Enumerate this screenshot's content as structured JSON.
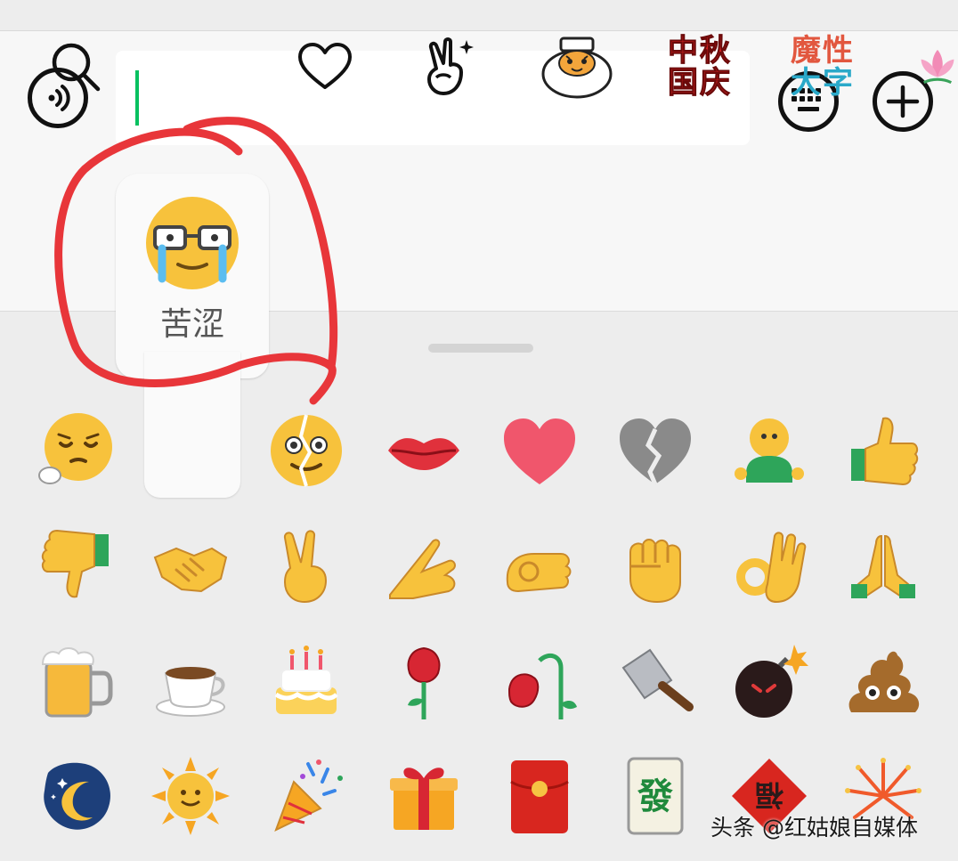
{
  "input": {
    "value": ""
  },
  "sticker_tabs": [
    {
      "name": "search-icon"
    },
    {
      "name": "emoji-tab",
      "label": "苦涩"
    },
    {
      "name": "heart-icon"
    },
    {
      "name": "hand-gesture-icon"
    },
    {
      "name": "tiger-sticker"
    },
    {
      "name": "sticker-pack-1",
      "text": "中秋国庆"
    },
    {
      "name": "sticker-pack-2",
      "text": "魔性大字"
    },
    {
      "name": "lotus-sticker"
    }
  ],
  "sticker_pack_1": {
    "line1": "中秋",
    "line2": "国庆"
  },
  "sticker_pack_2": {
    "line1": "魔性",
    "line2": "大字"
  },
  "preview": {
    "label": "苦涩",
    "icon": "bitter-tears-emoji"
  },
  "emoji_grid": [
    [
      "sigh-emoji",
      "",
      "crack-emoji",
      "lips-emoji",
      "heart-emoji",
      "broken-heart-emoji",
      "person-emoji",
      "thumbs-up-emoji"
    ],
    [
      "thumbs-down-emoji",
      "handshake-emoji",
      "victory-hand-emoji",
      "clap-hands-emoji",
      "fist-tap-emoji",
      "fist-emoji",
      "ok-hand-emoji",
      "pray-hands-emoji"
    ],
    [
      "beer-emoji",
      "coffee-emoji",
      "cake-emoji",
      "rose-emoji",
      "wilted-rose-emoji",
      "cleaver-emoji",
      "bomb-emoji",
      "poop-emoji"
    ],
    [
      "moon-emoji",
      "sun-emoji",
      "party-popper-emoji",
      "gift-emoji",
      "red-packet-emoji",
      "mahjong-fa-emoji",
      "fu-emoji",
      "fireworks-emoji"
    ]
  ],
  "mahjong_text": "發",
  "fu_text": "福",
  "watermark": "头条 @红姑娘自媒体",
  "colors": {
    "accent": "#07c160",
    "annotation": "#e8363a",
    "emoji_yellow": "#f7c23c"
  }
}
